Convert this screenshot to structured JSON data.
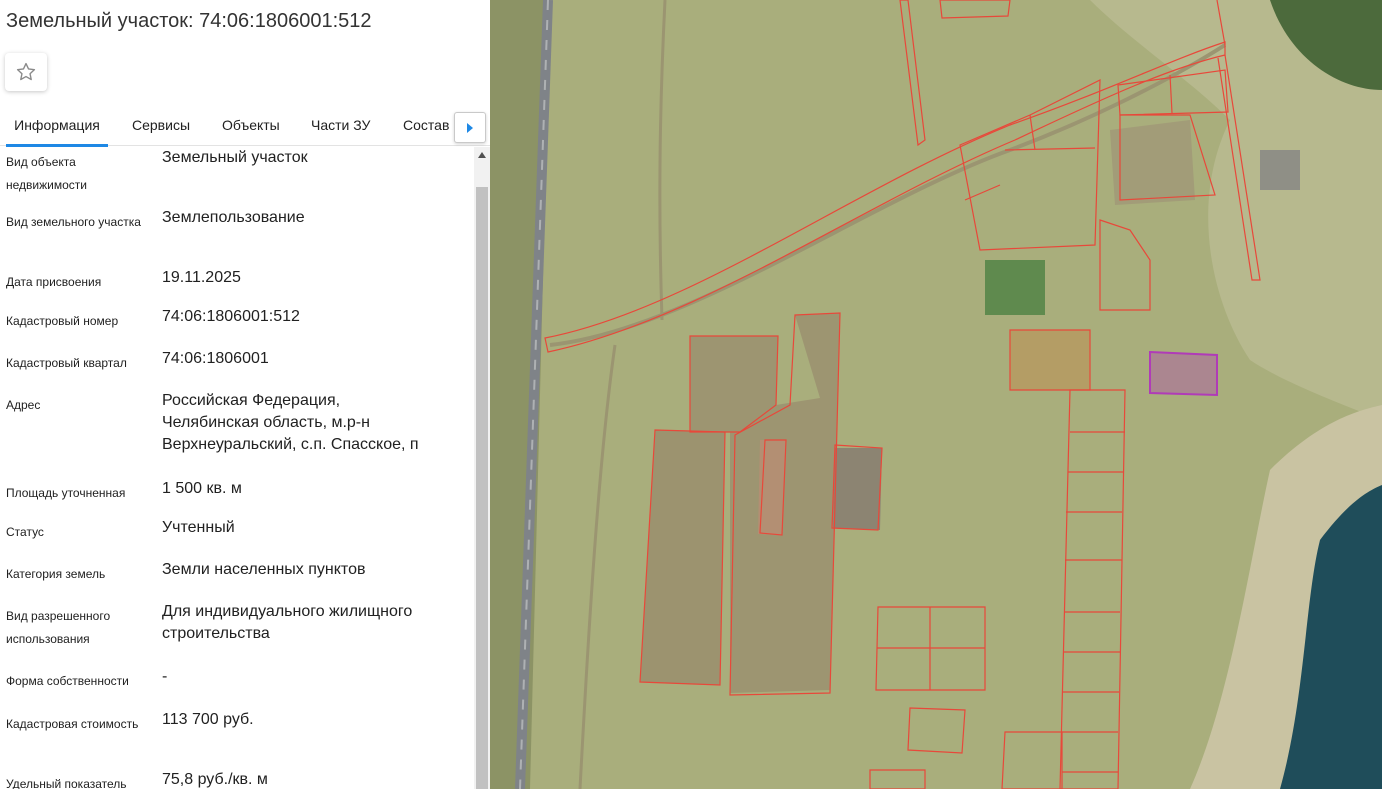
{
  "header": {
    "title": "Земельный участок: 74:06:1806001:512"
  },
  "tabs": [
    {
      "label": "Информация",
      "active": true
    },
    {
      "label": "Сервисы",
      "active": false
    },
    {
      "label": "Объекты",
      "active": false
    },
    {
      "label": "Части ЗУ",
      "active": false
    },
    {
      "label": "Состав",
      "active": false
    }
  ],
  "icons": {
    "favorite": "star-outline-icon",
    "tabs_next": "caret-right-icon",
    "scroll_up": "caret-up-icon"
  },
  "info": [
    {
      "label": "Вид объекта недвижимости",
      "value": "Земельный участок"
    },
    {
      "label": "Вид земельного участка",
      "value": "Землепользование"
    },
    {
      "label": "Дата присвоения",
      "value": "19.11.2025"
    },
    {
      "label": "Кадастровый номер",
      "value": "74:06:1806001:512"
    },
    {
      "label": "Кадастровый квартал",
      "value": "74:06:1806001"
    },
    {
      "label": "Адрес",
      "value": "Российская Федерация,\nЧелябинская область, м.р-н\nВерхнеуральский, с.п. Спасское, п"
    },
    {
      "label": "Площадь уточненная",
      "value": "1 500 кв. м"
    },
    {
      "label": "Статус",
      "value": "Учтенный"
    },
    {
      "label": "Категория земель",
      "value": "Земли населенных пунктов"
    },
    {
      "label": "Вид разрешенного использования",
      "value": "Для индивидуального жилищного\nстроительства"
    },
    {
      "label": "Форма собственности",
      "value": "-"
    },
    {
      "label": "Кадастровая стоимость",
      "value": "113 700 руб."
    },
    {
      "label": "Удельный показатель",
      "value": "75,8 руб./кв. м"
    }
  ],
  "colors": {
    "accent": "#1e88e5",
    "parcel_border": "#e8483a",
    "selected_parcel": "#b03bb8",
    "water": "#1f4d5a"
  }
}
